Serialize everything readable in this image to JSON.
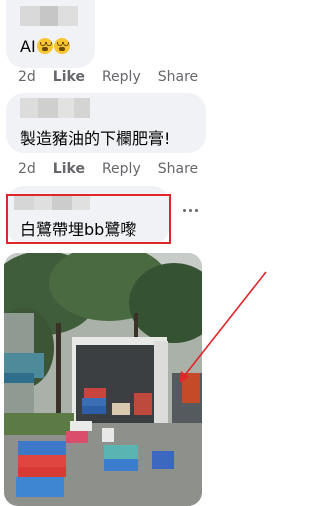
{
  "comments": [
    {
      "text": "AI",
      "emoji_count": 2
    },
    {
      "text": "製造豬油的下欄肥膏!"
    },
    {
      "text": "白鷺帶埋bb鷺嚟"
    }
  ],
  "actions": {
    "time": "2d",
    "like": "Like",
    "reply": "Reply",
    "share": "Share"
  },
  "icons": [
    "face-emoji-icon",
    "more-options-icon",
    "red-arrow-annotation"
  ],
  "colors": {
    "highlight": "#e0262b",
    "action_text": "#65676b",
    "bubble": "#f0f2f5"
  }
}
